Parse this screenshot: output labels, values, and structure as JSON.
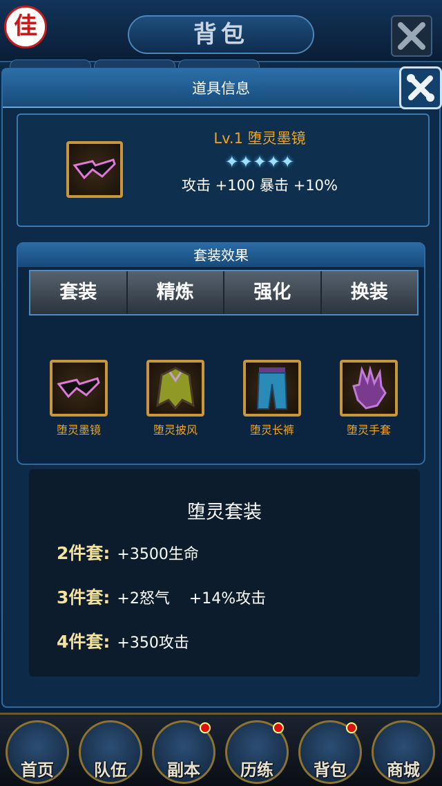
{
  "background": {
    "title": "背包",
    "avatar_char": "佳"
  },
  "popup": {
    "title": "道具信息"
  },
  "item": {
    "name": "Lv.1 堕灵墨镜",
    "stars": "✦✦✦✦✦",
    "stats": "攻击 +100  暴击 +10%"
  },
  "set": {
    "header": "套装效果",
    "tabs": [
      "套装",
      "精炼",
      "强化",
      "换装"
    ],
    "pieces": [
      {
        "label": "堕灵墨镜",
        "icon": "glasses-icon"
      },
      {
        "label": "堕灵披风",
        "icon": "cloak-icon"
      },
      {
        "label": "堕灵长裤",
        "icon": "pants-icon"
      },
      {
        "label": "堕灵手套",
        "icon": "glove-icon"
      }
    ],
    "title": "堕灵套装",
    "bonuses": [
      {
        "key": "2件套:",
        "value": "+3500生命"
      },
      {
        "key": "3件套:",
        "value": "+2怒气    +14%攻击"
      },
      {
        "key": "4件套:",
        "value": "+350攻击"
      }
    ]
  },
  "nav": {
    "items": [
      {
        "label": "首页",
        "dot": false
      },
      {
        "label": "队伍",
        "dot": false
      },
      {
        "label": "副本",
        "dot": true
      },
      {
        "label": "历练",
        "dot": true
      },
      {
        "label": "背包",
        "dot": true
      },
      {
        "label": "商城",
        "dot": false
      }
    ]
  },
  "colors": {
    "accent_gold": "#f0a51a",
    "bonus_key": "#f5e39c",
    "frame_blue": "#2f6aa0"
  }
}
